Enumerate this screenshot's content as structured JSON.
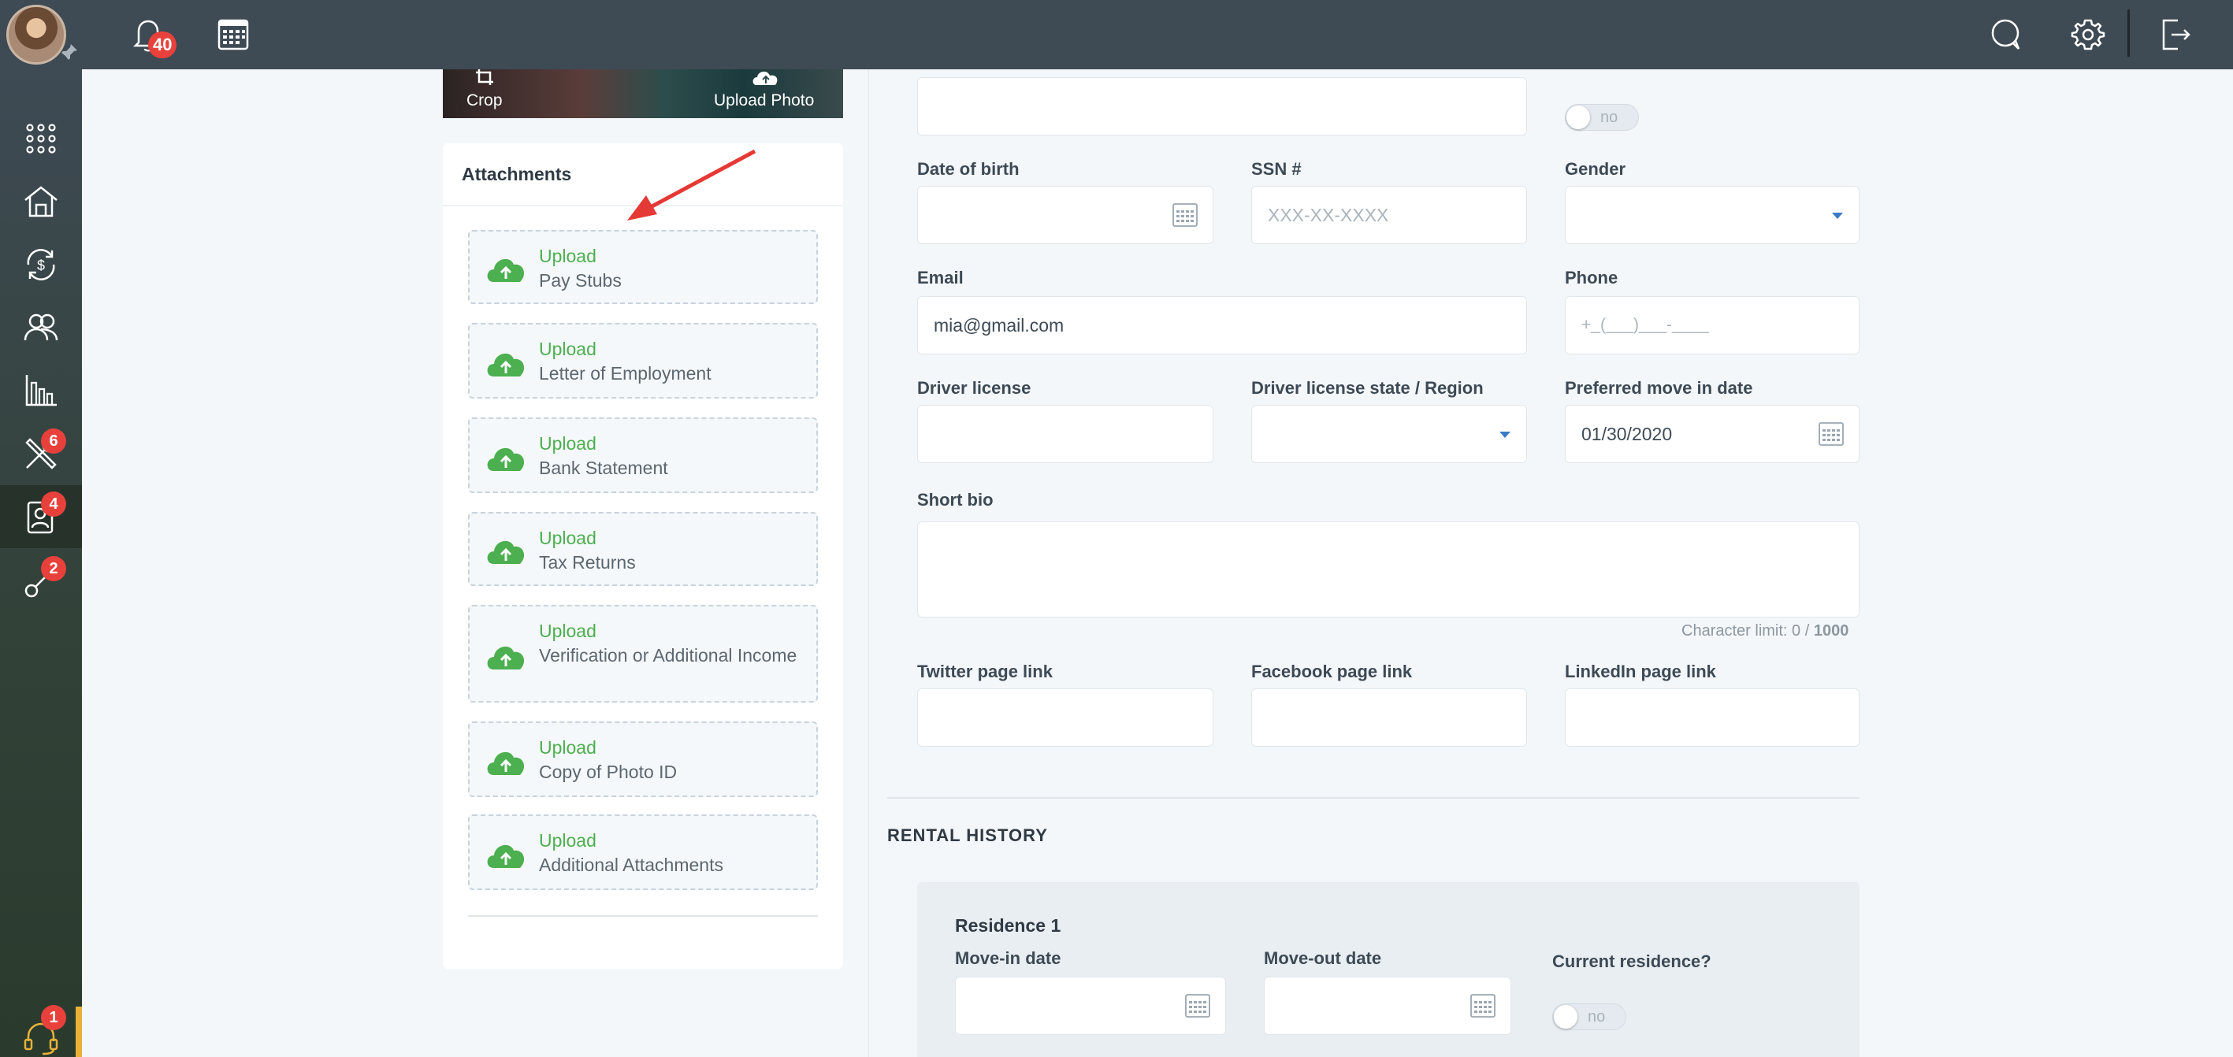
{
  "topbar": {
    "notifications_count": "40"
  },
  "sidebar": {
    "badges": {
      "tools": "6",
      "tenants": "4",
      "keys": "2",
      "support": "1"
    }
  },
  "photo": {
    "crop_label": "Crop",
    "upload_label": "Upload Photo"
  },
  "attachments": {
    "title": "Attachments",
    "items": [
      {
        "action": "Upload",
        "label": "Pay Stubs"
      },
      {
        "action": "Upload",
        "label": "Letter of Employment"
      },
      {
        "action": "Upload",
        "label": "Bank Statement"
      },
      {
        "action": "Upload",
        "label": "Tax Returns"
      },
      {
        "action": "Upload",
        "label": "Verification or Additional Income"
      },
      {
        "action": "Upload",
        "label": "Copy of Photo ID"
      },
      {
        "action": "Upload",
        "label": "Additional Attachments"
      }
    ]
  },
  "form": {
    "top_toggle": "no",
    "dob_label": "Date of birth",
    "ssn_label": "SSN #",
    "ssn_placeholder": "XXX-XX-XXXX",
    "gender_label": "Gender",
    "email_label": "Email",
    "email_value": "mia@gmail.com",
    "phone_label": "Phone",
    "phone_placeholder": "+_(___)___-____",
    "driver_license_label": "Driver license",
    "dl_state_label": "Driver license state / Region",
    "move_in_label": "Preferred move in date",
    "move_in_value": "01/30/2020",
    "bio_label": "Short bio",
    "char_limit_prefix": "Character limit: 0 /",
    "char_limit_max": "1000",
    "twitter_label": "Twitter page link",
    "facebook_label": "Facebook page link",
    "linkedin_label": "LinkedIn page link"
  },
  "rental_history": {
    "title": "RENTAL HISTORY",
    "residence_title": "Residence 1",
    "move_in_label": "Move-in date",
    "move_out_label": "Move-out date",
    "current_label": "Current residence?",
    "current_toggle": "no"
  },
  "colors": {
    "topbar": "#3e4a54",
    "accent_green": "#4caf50",
    "badge_red": "#e8413c"
  }
}
